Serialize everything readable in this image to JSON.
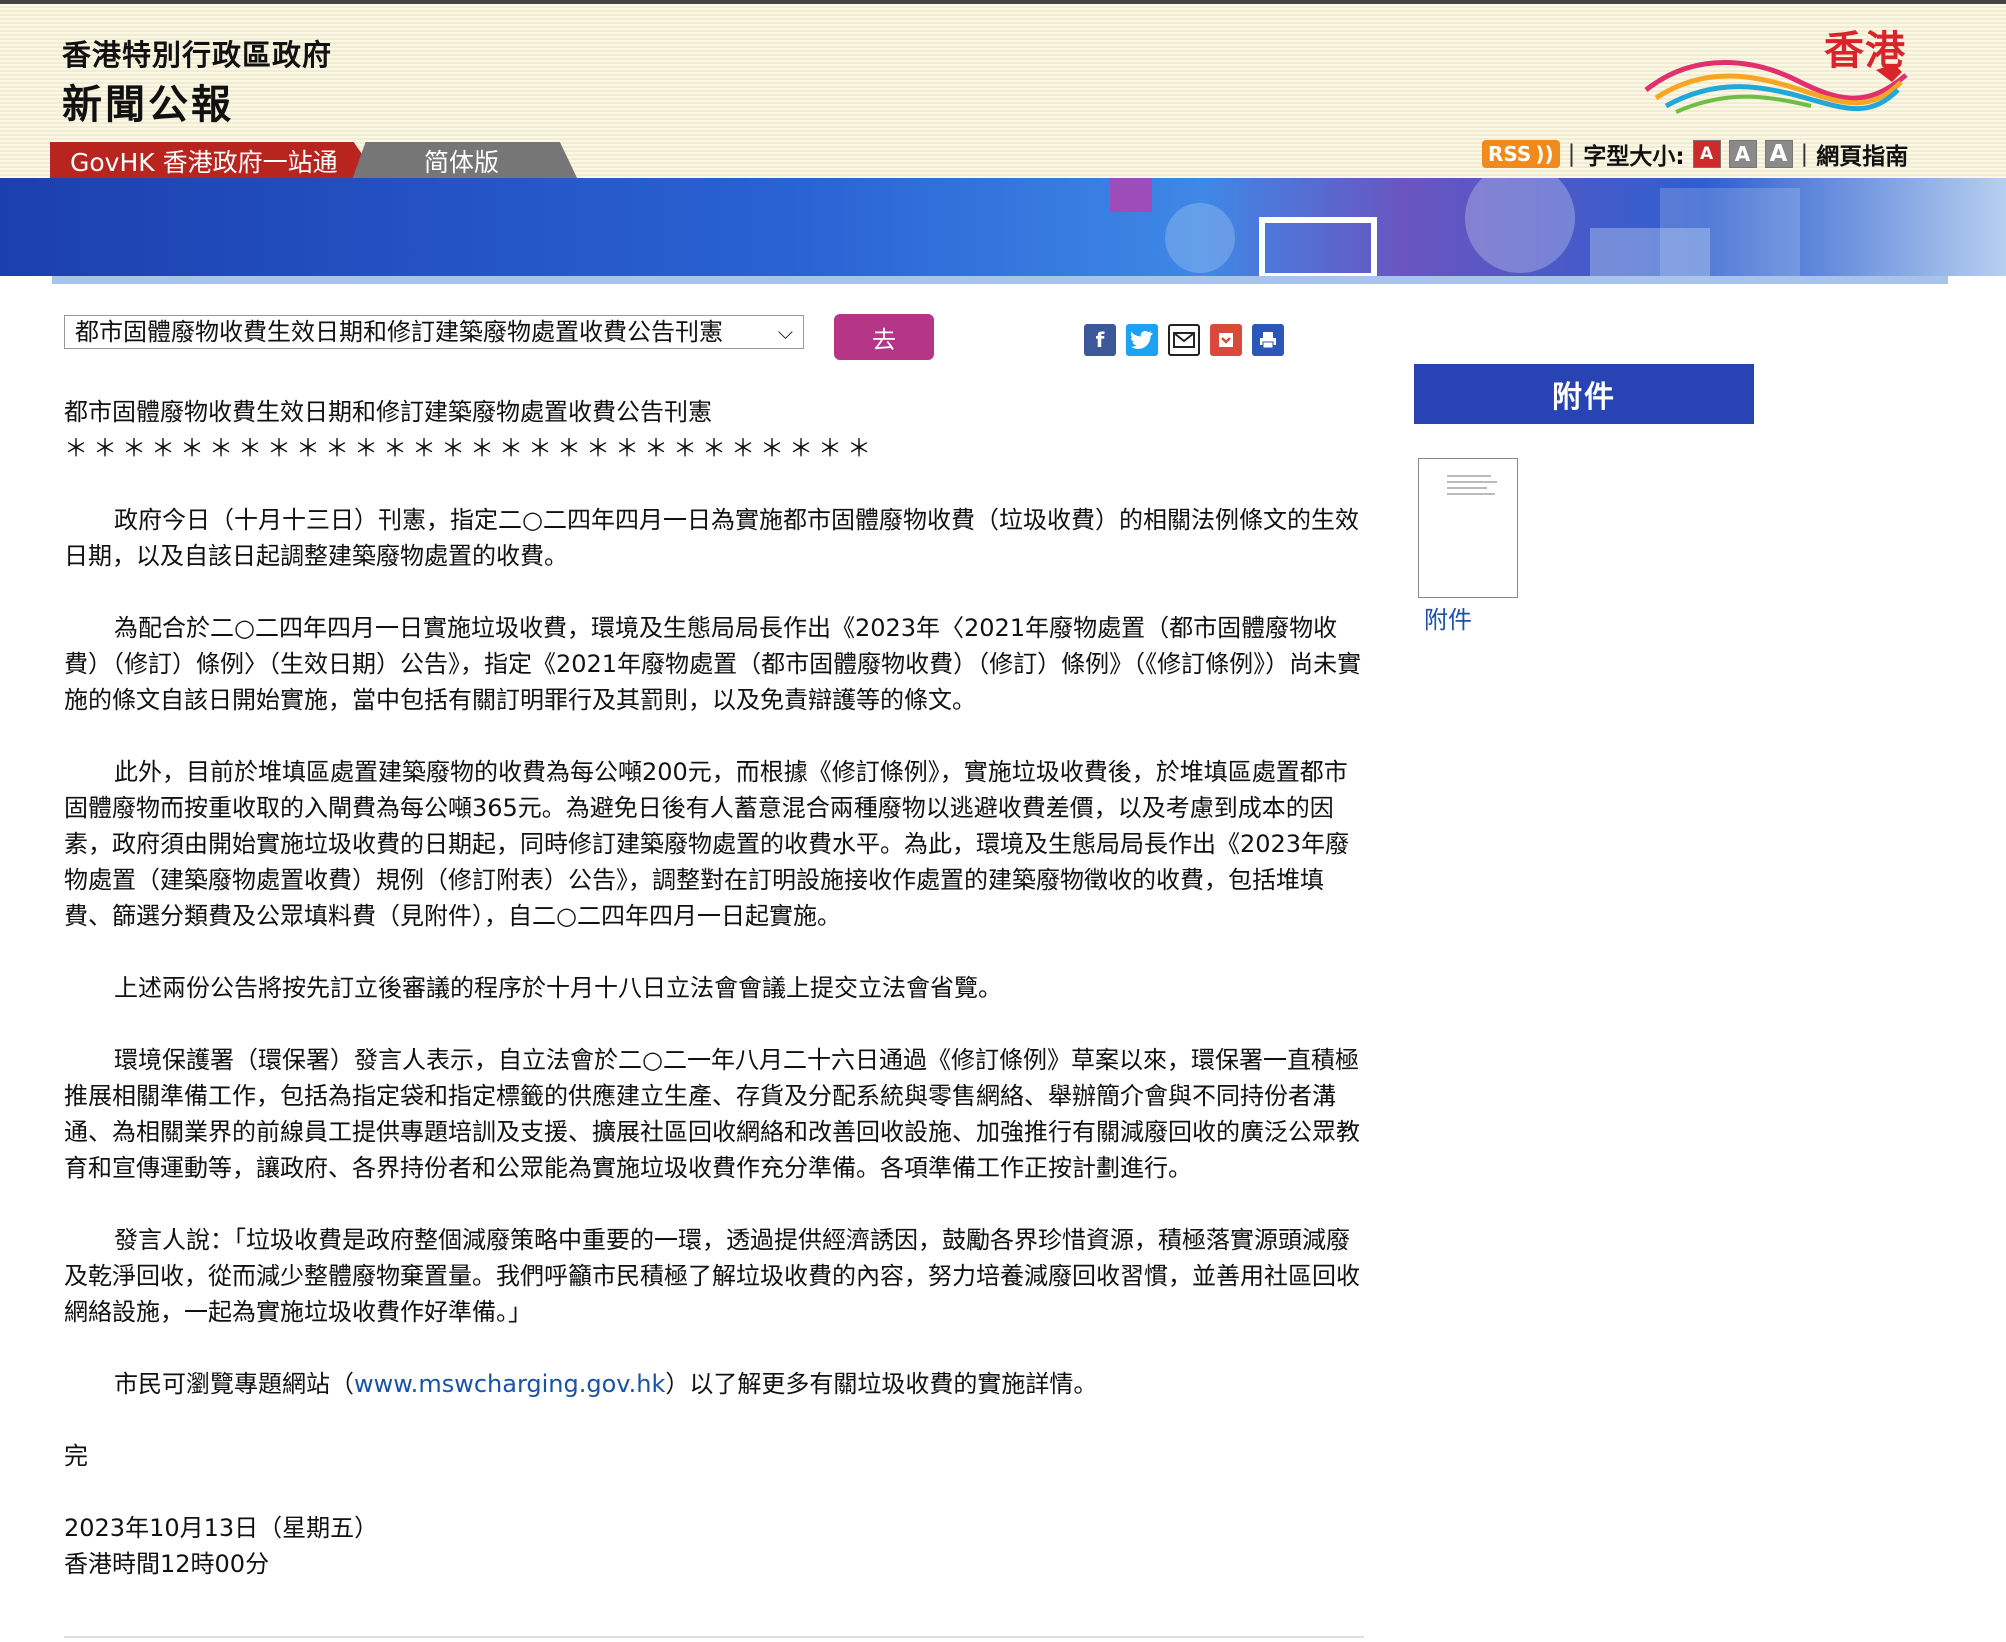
{
  "header": {
    "gov_name": "香港特別行政區政府",
    "site_title": "新聞公報",
    "logo_text": "香港"
  },
  "tabs": {
    "govhk": "GovHK 香港政府一站通",
    "simplified": "简体版"
  },
  "tools": {
    "rss": "RSS",
    "font_size_label": "字型大小:",
    "font_buttons": [
      "A",
      "A",
      "A"
    ],
    "guide": "網頁指南"
  },
  "nav": {
    "selected": "都市固體廢物收費生效日期和修訂建築廢物處置收費公告刊憲",
    "go": "去"
  },
  "share_icons": [
    "facebook-icon",
    "twitter-icon",
    "email-icon",
    "bookmark-icon",
    "print-icon"
  ],
  "article": {
    "title": "都市固體廢物收費生效日期和修訂建築廢物處置收費公告刊憲",
    "stars": "＊＊＊＊＊＊＊＊＊＊＊＊＊＊＊＊＊＊＊＊＊＊＊＊＊＊＊＊",
    "p1": "政府今日（十月十三日）刊憲，指定二○二四年四月一日為實施都市固體廢物收費（垃圾收費）的相關法例條文的生效日期，以及自該日起調整建築廢物處置的收費。",
    "p2": "為配合於二○二四年四月一日實施垃圾收費，環境及生態局局長作出《2023年〈2021年廢物處置（都市固體廢物收費）（修訂）條例〉（生效日期）公告》，指定《2021年廢物處置（都市固體廢物收費）（修訂）條例》（《修訂條例》）尚未實施的條文自該日開始實施，當中包括有關訂明罪行及其罰則，以及免責辯護等的條文。",
    "p3": "此外，目前於堆填區處置建築廢物的收費為每公噸200元，而根據《修訂條例》，實施垃圾收費後，於堆填區處置都市固體廢物而按重收取的入閘費為每公噸365元。為避免日後有人蓄意混合兩種廢物以逃避收費差價，以及考慮到成本的因素，政府須由開始實施垃圾收費的日期起，同時修訂建築廢物處置的收費水平。為此，環境及生態局局長作出《2023年廢物處置（建築廢物處置收費）規例（修訂附表）公告》，調整對在訂明設施接收作處置的建築廢物徵收的收費，包括堆填費、篩選分類費及公眾填料費（見附件），自二○二四年四月一日起實施。",
    "p4": "上述兩份公告將按先訂立後審議的程序於十月十八日立法會會議上提交立法會省覽。",
    "p5": "環境保護署（環保署）發言人表示，自立法會於二○二一年八月二十六日通過《修訂條例》草案以來，環保署一直積極推展相關準備工作，包括為指定袋和指定標籤的供應建立生產、存貨及分配系統與零售網絡、舉辦簡介會與不同持份者溝通、為相關業界的前線員工提供專題培訓及支援、擴展社區回收網絡和改善回收設施、加強推行有關減廢回收的廣泛公眾教育和宣傳運動等，讓政府、各界持份者和公眾能為實施垃圾收費作充分準備。各項準備工作正按計劃進行。",
    "p6": "發言人說：「垃圾收費是政府整個減廢策略中重要的一環，透過提供經濟誘因，鼓勵各界珍惜資源，積極落實源頭減廢及乾淨回收，從而減少整體廢物棄置量。我們呼籲市民積極了解垃圾收費的內容，努力培養減廢回收習慣，並善用社區回收網絡設施，一起為實施垃圾收費作好準備。」",
    "p7_pre": "市民可瀏覽專題網站（",
    "p7_link": "www.mswcharging.gov.hk",
    "p7_post": "）以了解更多有關垃圾收費的實施詳情。",
    "end": "完",
    "date": "2023年10月13日（星期五）",
    "time": "香港時間12時00分"
  },
  "attachment": {
    "heading": "附件",
    "link": "附件"
  },
  "colors": {
    "go_button": "#b53687",
    "attach_heading": "#2844b4",
    "govhk_tab": "#b8251f",
    "link": "#1a52a8"
  }
}
